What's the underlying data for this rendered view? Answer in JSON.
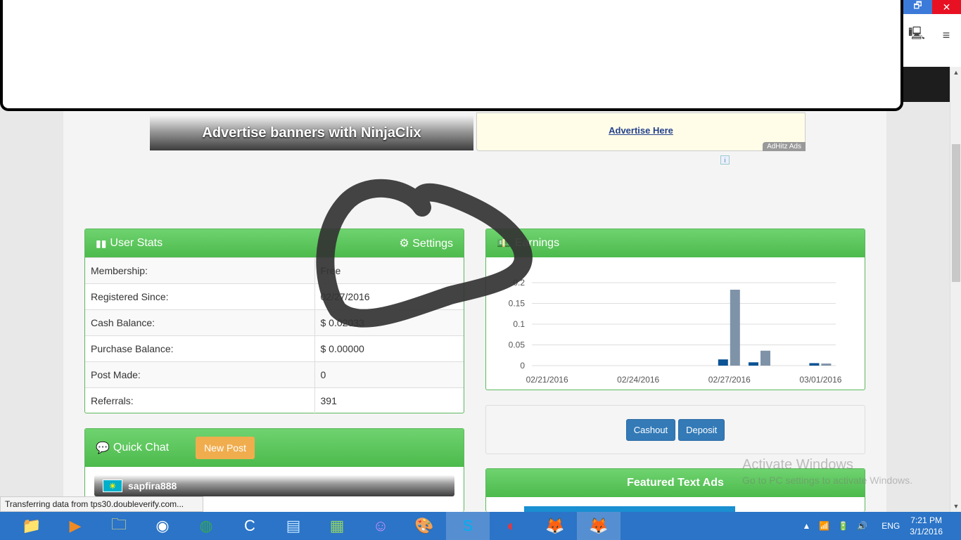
{
  "window": {
    "restore_label": "🗗",
    "close_label": "✕"
  },
  "banners": {
    "ninjaclix_text": "Advertise banners with NinjaClix",
    "adhitz_link": "Advertise Here",
    "adhitz_tag": "AdHitz Ads"
  },
  "user_stats": {
    "title": "User Stats",
    "settings_label": "Settings",
    "rows": [
      {
        "label": "Membership:",
        "value": "Free"
      },
      {
        "label": "Registered Since:",
        "value": "02/27/2016"
      },
      {
        "label": "Cash Balance:",
        "value": "$ 0.02033"
      },
      {
        "label": "Purchase Balance:",
        "value": "$ 0.00000"
      },
      {
        "label": "Post Made:",
        "value": "0"
      },
      {
        "label": "Referrals:",
        "value": "391"
      }
    ]
  },
  "quick_chat": {
    "title": "Quick Chat",
    "new_post_label": "New Post",
    "user": "sapfira888"
  },
  "earnings": {
    "title": "Earnings"
  },
  "actions": {
    "cashout_label": "Cashout",
    "deposit_label": "Deposit"
  },
  "featured": {
    "title": "Featured Text Ads"
  },
  "chart_data": {
    "type": "bar",
    "title": "",
    "x_ticks": [
      "02/21/2016",
      "02/24/2016",
      "02/27/2016",
      "03/01/2016"
    ],
    "y_ticks": [
      "0",
      "0.05",
      "0.1",
      "0.15",
      "0.2"
    ],
    "ylim": [
      0,
      0.2
    ],
    "categories": [
      "02/21/2016",
      "02/22/2016",
      "02/23/2016",
      "02/24/2016",
      "02/25/2016",
      "02/26/2016",
      "02/27/2016",
      "02/28/2016",
      "02/29/2016",
      "03/01/2016"
    ],
    "series": [
      {
        "color": "#0b5394",
        "values": [
          0,
          0,
          0,
          0,
          0,
          0,
          0.015,
          0.008,
          0,
          0.006
        ]
      },
      {
        "color": "#7f93a8",
        "values": [
          0,
          0,
          0,
          0,
          0,
          0,
          0.183,
          0.036,
          0,
          0.005
        ]
      }
    ]
  },
  "status_bar": {
    "text": "Transferring data from tps30.doubleverify.com..."
  },
  "watermark": {
    "line1": "Activate Windows",
    "line2": "Go to PC settings to activate Windows."
  },
  "taskbar": {
    "apps": [
      {
        "name": "file-explorer-icon",
        "glyph": "📁",
        "color": "#f5c842"
      },
      {
        "name": "media-player-icon",
        "glyph": "▶",
        "color": "#f08a24"
      },
      {
        "name": "folder-icon",
        "glyph": "🗀",
        "color": "#ffe27a"
      },
      {
        "name": "uc-browser-icon",
        "glyph": "◉",
        "color": "#ffffff"
      },
      {
        "name": "chrome-icon",
        "glyph": "◍",
        "color": "#34a853"
      },
      {
        "name": "ccleaner-icon",
        "glyph": "C",
        "color": "#ffffff"
      },
      {
        "name": "notepad-icon",
        "glyph": "▤",
        "color": "#bfe3ff"
      },
      {
        "name": "spreadsheet-icon",
        "glyph": "▦",
        "color": "#8fd16a"
      },
      {
        "name": "yahoo-messenger-icon",
        "glyph": "☺",
        "color": "#c78fff"
      },
      {
        "name": "paint-icon",
        "glyph": "🎨",
        "color": "#ffd27a"
      },
      {
        "name": "skype-icon",
        "glyph": "S",
        "color": "#00aff0",
        "active": true
      },
      {
        "name": "ccleaner-2-icon",
        "glyph": "◐",
        "color": "#ff3030"
      },
      {
        "name": "firefox-icon",
        "glyph": "🦊",
        "color": "#ff7a1a"
      },
      {
        "name": "firefox-active-icon",
        "glyph": "🦊",
        "color": "#ff7a1a",
        "active": true
      }
    ],
    "lang": "ENG",
    "time": "7:21 PM",
    "date": "3/1/2016"
  }
}
